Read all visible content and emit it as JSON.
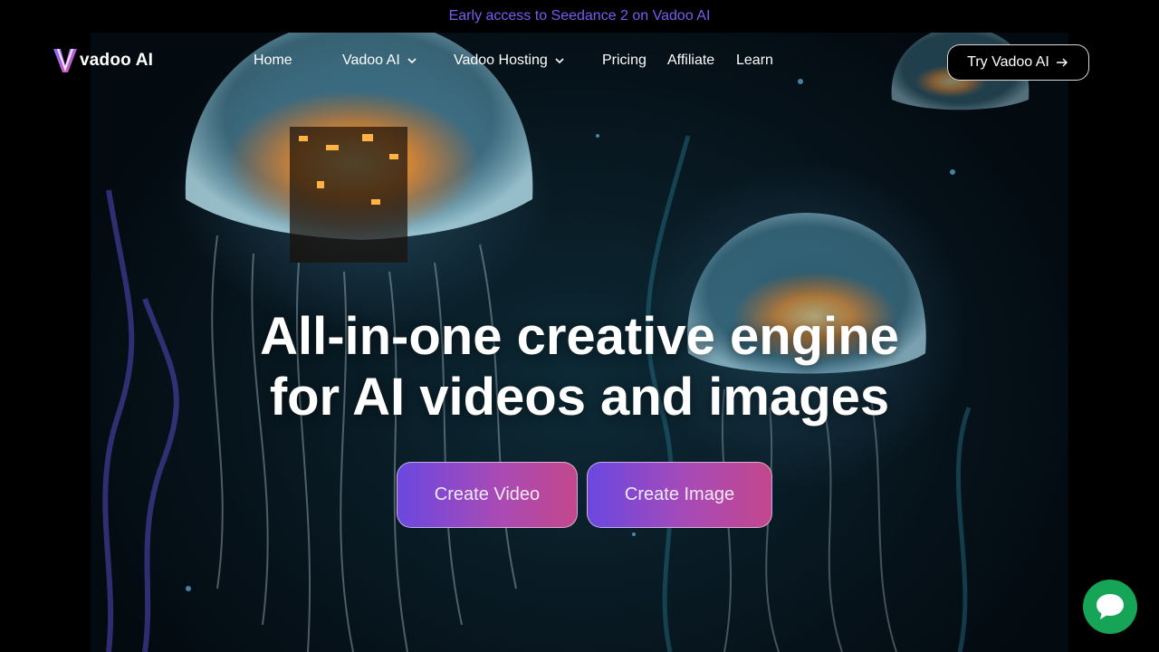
{
  "announcement": {
    "text": "Early access to Seedance 2 on Vadoo AI"
  },
  "brand": {
    "name": "vadoo AI"
  },
  "nav": {
    "items": [
      {
        "label": "Home",
        "has_dropdown": false
      },
      {
        "label": "Vadoo AI",
        "has_dropdown": true
      },
      {
        "label": "Vadoo Hosting",
        "has_dropdown": true
      },
      {
        "label": "Pricing",
        "has_dropdown": false
      },
      {
        "label": "Affiliate",
        "has_dropdown": false
      },
      {
        "label": "Learn",
        "has_dropdown": false
      }
    ],
    "cta_label": "Try Vadoo AI"
  },
  "hero": {
    "headline_line1": "All-in-one creative engine",
    "headline_line2": "for AI videos and images",
    "primary_button": "Create Video",
    "secondary_button": "Create Image"
  },
  "icons": {
    "logo": "vadoo-logo-icon",
    "dropdown": "chevron-down-icon",
    "cta": "arrow-right-icon",
    "chat": "chat-bubble-icon"
  },
  "colors": {
    "announcement": "#7b5cf0",
    "button_gradient_start": "#6a48e0",
    "button_gradient_end": "#c2478c",
    "chat_widget": "#16a556",
    "page_background": "#000000"
  }
}
